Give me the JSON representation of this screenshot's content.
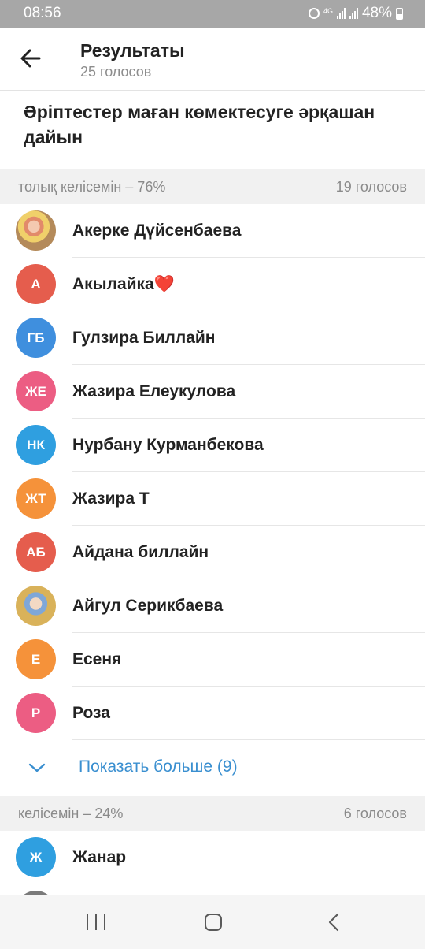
{
  "status_bar": {
    "time": "08:56",
    "network": "4G",
    "battery": "48%"
  },
  "header": {
    "title": "Результаты",
    "subtitle": "25 голосов"
  },
  "question": "Әріптестер маған көмектесуге әрқашан дайын",
  "sections": [
    {
      "label": "толық келісемін – 76%",
      "votes": "19 голосов",
      "voters": [
        {
          "name": "Акерке Дүйсенбаева",
          "initials": "",
          "color": "#d9a066",
          "photo": true
        },
        {
          "name": "Акылайка❤️",
          "initials": "А",
          "color": "#e55d4d"
        },
        {
          "name": "Гулзира Биллайн",
          "initials": "ГБ",
          "color": "#3f8fde"
        },
        {
          "name": "Жазира Елеукулова",
          "initials": "ЖЕ",
          "color": "#ec5d83"
        },
        {
          "name": "Нурбану Курманбекова",
          "initials": "НК",
          "color": "#2f9fe0"
        },
        {
          "name": "Жазира Т",
          "initials": "ЖТ",
          "color": "#f5923a"
        },
        {
          "name": "Айдана биллайн",
          "initials": "АБ",
          "color": "#e55d4d"
        },
        {
          "name": "Айгул Серикбаева",
          "initials": "",
          "color": "#c9a450",
          "photo": true
        },
        {
          "name": "Есеня",
          "initials": "Е",
          "color": "#f5923a"
        },
        {
          "name": "Роза",
          "initials": "Р",
          "color": "#ec5d83"
        }
      ],
      "show_more": "Показать больше (9)"
    },
    {
      "label": "келісемін – 24%",
      "votes": "6 голосов",
      "voters": [
        {
          "name": "Жанар",
          "initials": "Ж",
          "color": "#2f9fe0"
        }
      ]
    }
  ],
  "icons": {
    "back": "arrow-left-icon",
    "expand": "chevron-down-icon"
  }
}
